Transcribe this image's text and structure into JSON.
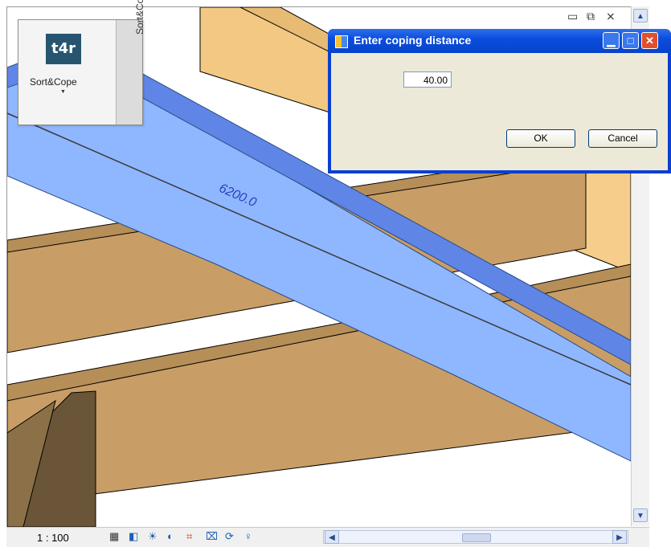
{
  "viewport": {
    "dimension_label": "6200.0"
  },
  "window_controls": {
    "minimize_label": "▭",
    "restore_label": "⧉",
    "close_label": "⨯",
    "up_label": "▲"
  },
  "ribbon": {
    "logo_text": "t4r",
    "button_label": "Sort&Cope",
    "tab_label": "Sort&Cope"
  },
  "dialog": {
    "title": "Enter coping distance",
    "distance_value": "40.00",
    "ok_label": "OK",
    "cancel_label": "Cancel"
  },
  "status": {
    "scale": "1 : 100",
    "icons": [
      "detail-level-icon",
      "visual-style-icon",
      "sun-path-icon",
      "shadows-icon",
      "crop-icon",
      "show-crop-icon",
      "temporary-hide-icon",
      "reveal-hidden-icon"
    ]
  },
  "colors": {
    "beam_blue": "#8fb7ff",
    "beam_top_blue": "#5f86e6",
    "wood": "#c9a36b",
    "wood_light": "#f0c880",
    "dialog_blue": "#0a3fd1"
  }
}
